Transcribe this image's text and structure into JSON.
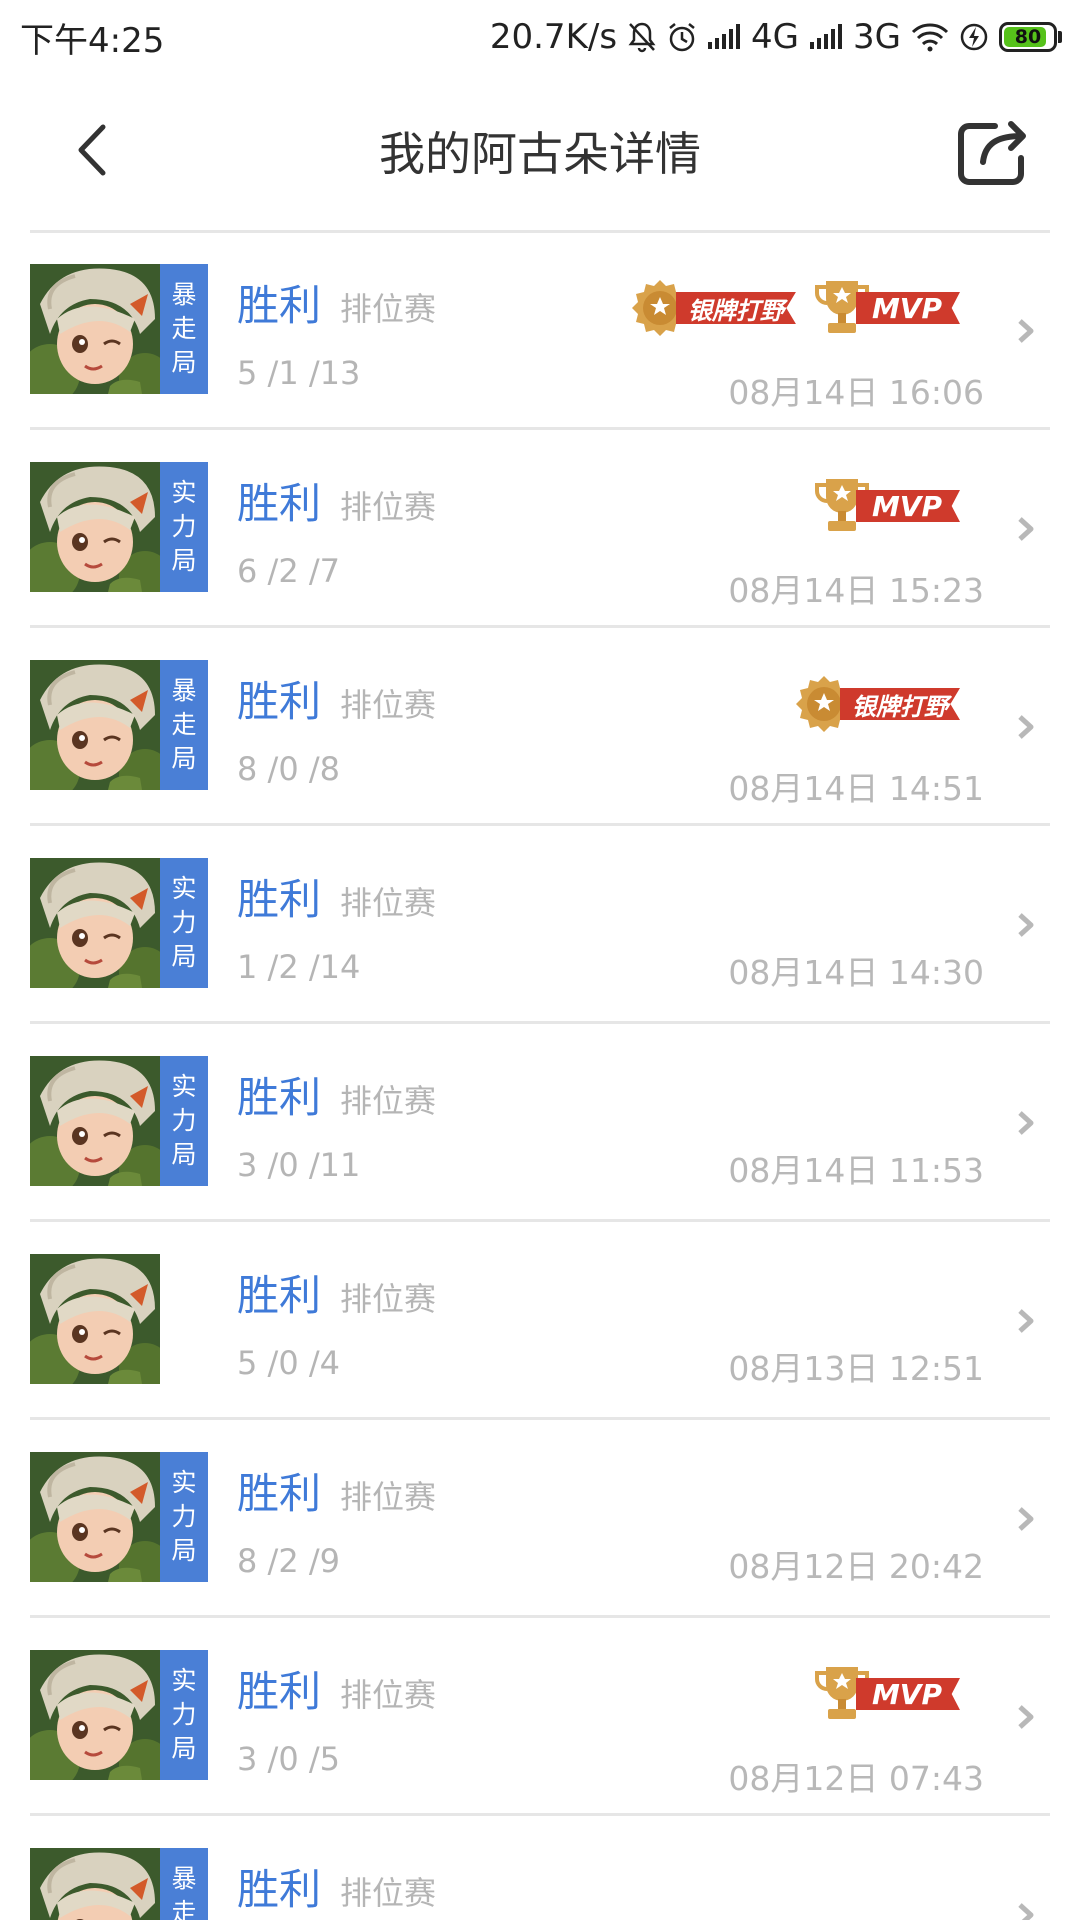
{
  "status_bar": {
    "time": "下午4:25",
    "speed": "20.7K/s",
    "network1": "4G",
    "network2": "3G",
    "battery": "80"
  },
  "header": {
    "title": "我的阿古朵详情"
  },
  "matches": [
    {
      "mode": "暴走局",
      "result": "胜利",
      "type": "排位赛",
      "kda": "5 /1 /13",
      "time": "08月14日 16:06",
      "badges": [
        "银牌打野",
        "MVP"
      ]
    },
    {
      "mode": "实力局",
      "result": "胜利",
      "type": "排位赛",
      "kda": "6 /2 /7",
      "time": "08月14日 15:23",
      "badges": [
        "MVP"
      ]
    },
    {
      "mode": "暴走局",
      "result": "胜利",
      "type": "排位赛",
      "kda": "8 /0 /8",
      "time": "08月14日 14:51",
      "badges": [
        "银牌打野"
      ]
    },
    {
      "mode": "实力局",
      "result": "胜利",
      "type": "排位赛",
      "kda": "1 /2 /14",
      "time": "08月14日 14:30",
      "badges": []
    },
    {
      "mode": "实力局",
      "result": "胜利",
      "type": "排位赛",
      "kda": "3 /0 /11",
      "time": "08月14日 11:53",
      "badges": []
    },
    {
      "mode": "",
      "result": "胜利",
      "type": "排位赛",
      "kda": "5 /0 /4",
      "time": "08月13日 12:51",
      "badges": []
    },
    {
      "mode": "实力局",
      "result": "胜利",
      "type": "排位赛",
      "kda": "8 /2 /9",
      "time": "08月12日 20:42",
      "badges": []
    },
    {
      "mode": "实力局",
      "result": "胜利",
      "type": "排位赛",
      "kda": "3 /0 /5",
      "time": "08月12日 07:43",
      "badges": [
        "MVP"
      ]
    },
    {
      "mode": "暴走局",
      "result": "胜利",
      "type": "排位赛",
      "kda": "",
      "time": "",
      "badges": []
    }
  ],
  "colors": {
    "accent": "#3f7ad8",
    "mode_tag": "#4a7fd6",
    "badge_red": "#cf3a2c",
    "badge_gold": "#d9a24a"
  }
}
